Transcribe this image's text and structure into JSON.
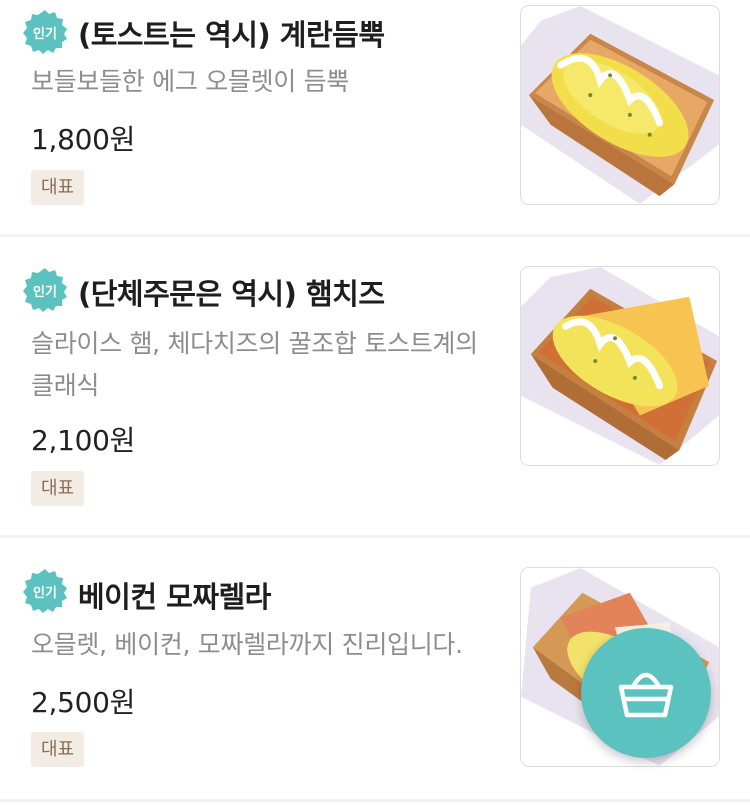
{
  "menu": {
    "items": [
      {
        "badge": "인기",
        "name": "(토스트는 역시) 계란듬뿍",
        "description": "보들보들한 에그 오믈렛이 듬뿍",
        "price": "1,800원",
        "tag": "대표",
        "image_icon": "egg-toast-photo"
      },
      {
        "badge": "인기",
        "name": "(단체주문은 역시) 햄치즈",
        "description": "슬라이스 햄, 체다치즈의 꿀조합 토스트계의 클래식",
        "price": "2,100원",
        "tag": "대표",
        "image_icon": "ham-cheese-toast-photo"
      },
      {
        "badge": "인기",
        "name": "베이컨 모짜렐라",
        "description": "오믈렛, 베이컨, 모짜렐라까지 진리입니다.",
        "price": "2,500원",
        "tag": "대표",
        "image_icon": "bacon-mozzarella-toast-photo"
      }
    ]
  },
  "colors": {
    "badge": "#5cc2c0",
    "cart_button": "#5cc2c0",
    "tag_background": "#f3ece4",
    "tag_text": "#8a6e55"
  },
  "cart_button": {
    "icon": "shopping-basket-icon"
  }
}
